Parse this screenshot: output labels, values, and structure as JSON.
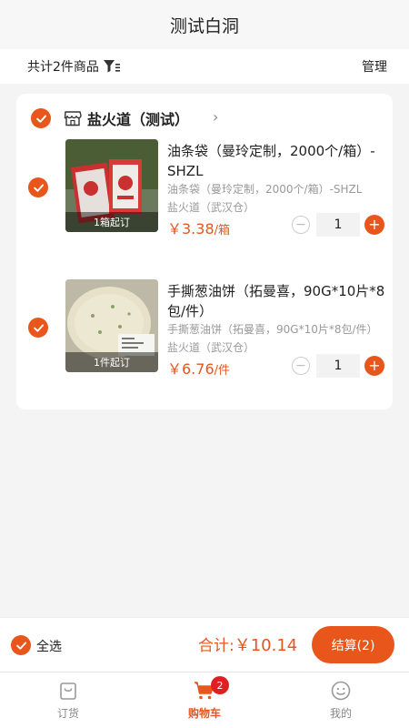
{
  "header": {
    "title": "测试白洞"
  },
  "subbar": {
    "count_text": "共计2件商品",
    "manage_label": "管理"
  },
  "shop": {
    "name": "盐火道（测试）"
  },
  "items": [
    {
      "name": "油条袋（曼玲定制，2000个/箱）-SHZL",
      "spec": "油条袋（曼玲定制，2000个/箱）-SHZL",
      "warehouse": "盐火道（武汉仓）",
      "price": "￥3.38",
      "unit": "/箱",
      "min_order": "1箱起订",
      "quantity": "1"
    },
    {
      "name": "手撕葱油饼（拓曼喜，90G*10片*8包/件）",
      "spec": "手撕葱油饼（拓曼喜，90G*10片*8包/件）",
      "warehouse": "盐火道（武汉仓）",
      "price": "￥6.76",
      "unit": "/件",
      "min_order": "1件起订",
      "quantity": "1"
    }
  ],
  "checkout": {
    "select_all_label": "全选",
    "total_label": "合计:",
    "total_amount": "￥10.14",
    "button_label": "结算(2)"
  },
  "tabs": [
    {
      "label": "订货",
      "icon": "shopping-bag-icon"
    },
    {
      "label": "购物车",
      "icon": "cart-icon",
      "badge": "2",
      "active": true
    },
    {
      "label": "我的",
      "icon": "smile-icon"
    }
  ],
  "colors": {
    "accent": "#e8561c",
    "badge": "#e02020"
  }
}
